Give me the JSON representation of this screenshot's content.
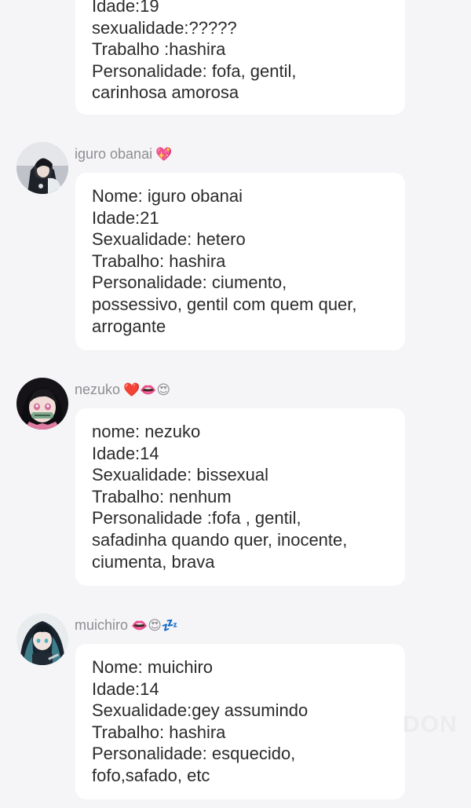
{
  "messages": [
    {
      "username": "",
      "emoji": "",
      "lines": [
        "Idade:19",
        "sexualidade:?????",
        "Trabalho :hashira",
        "Personalidade: fofa, gentil,",
        "carinhosa amorosa"
      ]
    },
    {
      "username": "iguro obanai",
      "emoji": "💖",
      "lines": [
        "Nome: iguro obanai",
        "Idade:21",
        "Sexualidade: hetero",
        "Trabalho: hashira",
        "Personalidade: ciumento,",
        "possessivo, gentil com quem quer,",
        "arrogante"
      ]
    },
    {
      "username": "nezuko",
      "emoji": "❤️👄😍",
      "lines": [
        "nome: nezuko",
        "Idade:14",
        "Sexualidade: bissexual",
        "Trabalho: nenhum",
        "Personalidade :fofa , gentil,",
        "safadinha quando quer, inocente,",
        "ciumenta, brava"
      ]
    },
    {
      "username": "muichiro",
      "emoji": "👄😍💤",
      "lines": [
        "Nome: muichiro",
        "Idade:14",
        "Sexualidade:gey assumindo",
        "Trabalho: hashira",
        "Personalidade: esquecido,",
        "fofo,safado, etc"
      ]
    }
  ],
  "watermark": "DON",
  "colors": {
    "background": "#f5f5f7",
    "bubble": "#ffffff",
    "text": "#2b2b2b",
    "username": "#8e8e93"
  }
}
